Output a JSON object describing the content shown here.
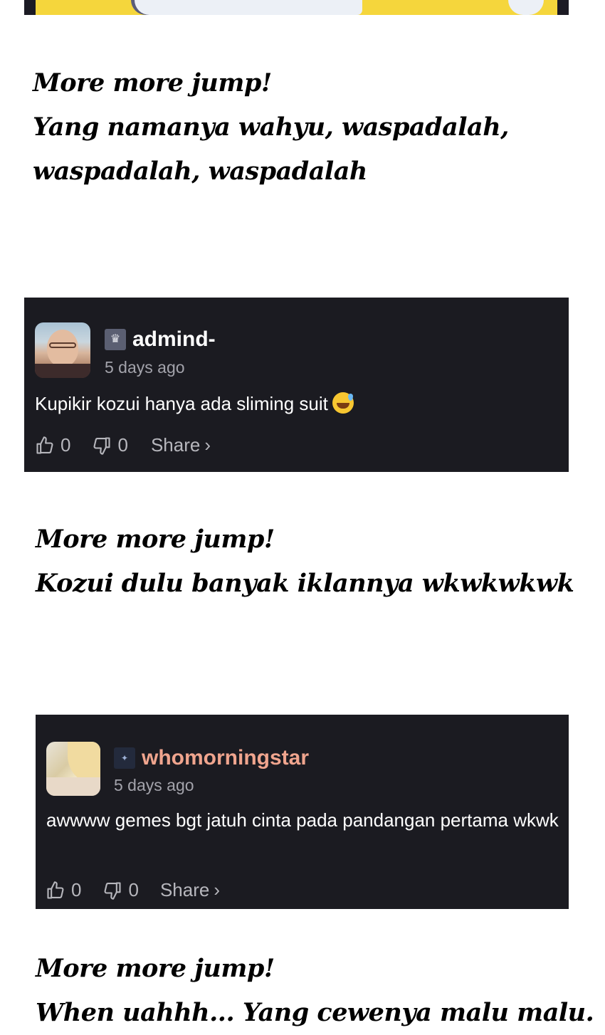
{
  "captions": [
    {
      "lines": [
        "More more jump!",
        "Yang namanya wahyu, waspadalah,",
        "waspadalah, waspadalah"
      ]
    },
    {
      "lines": [
        "More more jump!",
        "Kozui dulu banyak iklannya wkwkwkwk"
      ]
    },
    {
      "lines": [
        "More more jump!",
        "When uahhh... Yang cewenya malu malu."
      ]
    }
  ],
  "comments": [
    {
      "username": "admind-",
      "username_color": "#ffffff",
      "time": "5 days ago",
      "text": "Kupikir kozui hanya ada sliming suit",
      "emoji": "sweat-smile-emoji",
      "likes": "0",
      "dislikes": "0",
      "share_label": "Share"
    },
    {
      "username": "whomorningstar",
      "username_color": "#f0a58e",
      "time": "5 days ago",
      "text": "awwww gemes bgt jatuh cinta pada pandangan pertama wkwk",
      "likes": "0",
      "dislikes": "0",
      "share_label": "Share"
    }
  ],
  "icons": {
    "like": "thumbs-up-icon",
    "dislike": "thumbs-down-icon",
    "share": "chevron-right-icon"
  }
}
